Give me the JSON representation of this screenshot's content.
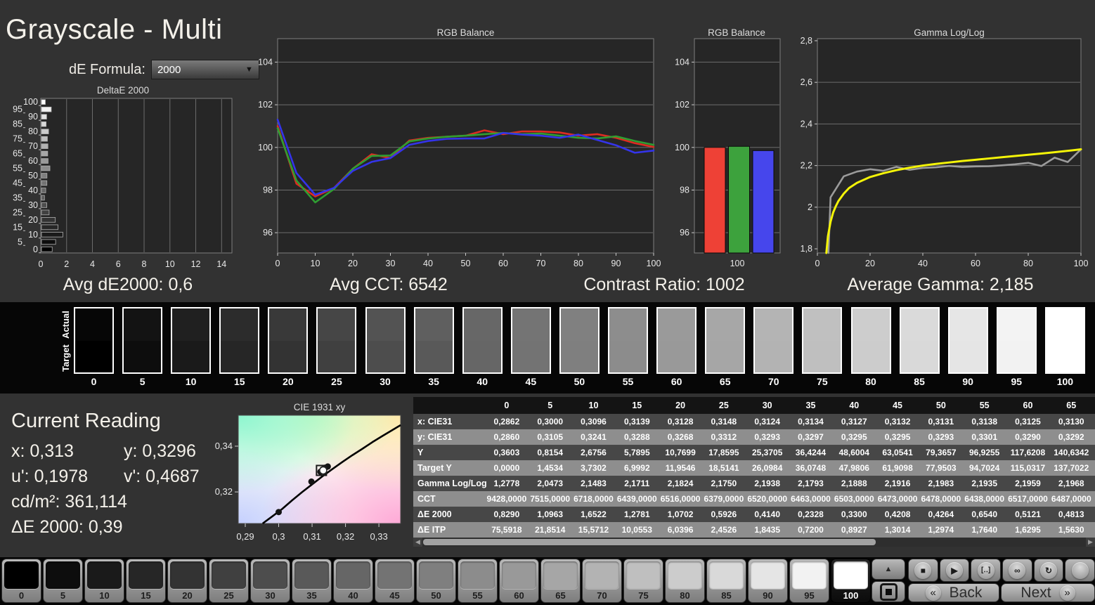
{
  "title": "Grayscale - Multi",
  "de_formula": {
    "label": "dE Formula:",
    "value": "2000"
  },
  "summary": {
    "avg_de": "Avg dE2000: 0,6",
    "avg_cct": "Avg CCT: 6542",
    "contrast": "Contrast Ratio: 1002",
    "avg_gamma": "Average Gamma: 2,185"
  },
  "strip": {
    "actual_label": "Actual",
    "target_label": "Target",
    "levels": [
      0,
      5,
      10,
      15,
      20,
      25,
      30,
      35,
      40,
      45,
      50,
      55,
      60,
      65,
      70,
      75,
      80,
      85,
      90,
      95,
      100
    ]
  },
  "current_reading": {
    "heading": "Current Reading",
    "row1": [
      "x: 0,313",
      "y: 0,3296"
    ],
    "row2": [
      "u': 0,1978",
      "v': 0,4687"
    ],
    "row3": "cd/m²: 361,114",
    "row4": "ΔE 2000: 0,39"
  },
  "table": {
    "col_headers": [
      "0",
      "5",
      "10",
      "15",
      "20",
      "25",
      "30",
      "35",
      "40",
      "45",
      "50",
      "55",
      "60",
      "65"
    ],
    "rows": [
      {
        "label": "x: CIE31",
        "values": [
          "0,2862",
          "0,3000",
          "0,3096",
          "0,3139",
          "0,3128",
          "0,3148",
          "0,3124",
          "0,3134",
          "0,3127",
          "0,3132",
          "0,3131",
          "0,3138",
          "0,3125",
          "0,3130"
        ]
      },
      {
        "label": "y: CIE31",
        "values": [
          "0,2860",
          "0,3105",
          "0,3241",
          "0,3288",
          "0,3268",
          "0,3312",
          "0,3293",
          "0,3297",
          "0,3295",
          "0,3295",
          "0,3293",
          "0,3301",
          "0,3290",
          "0,3292"
        ]
      },
      {
        "label": "Y",
        "values": [
          "0,3603",
          "0,8154",
          "2,6756",
          "5,7895",
          "10,7699",
          "17,8595",
          "25,3705",
          "36,4244",
          "48,6004",
          "63,0541",
          "79,3657",
          "96,9255",
          "117,6208",
          "140,6342"
        ]
      },
      {
        "label": "Target Y",
        "values": [
          "0,0000",
          "1,4534",
          "3,7302",
          "6,9992",
          "11,9546",
          "18,5141",
          "26,0984",
          "36,0748",
          "47,9806",
          "61,9098",
          "77,9503",
          "94,7024",
          "115,0317",
          "137,7022"
        ]
      },
      {
        "label": "Gamma Log/Log",
        "values": [
          "1,2778",
          "2,0473",
          "2,1483",
          "2,1711",
          "2,1824",
          "2,1750",
          "2,1938",
          "2,1793",
          "2,1888",
          "2,1916",
          "2,1983",
          "2,1935",
          "2,1959",
          "2,1968"
        ]
      },
      {
        "label": "CCT",
        "values": [
          "9428,0000",
          "7515,0000",
          "6718,0000",
          "6439,0000",
          "6516,0000",
          "6379,0000",
          "6520,0000",
          "6463,0000",
          "6503,0000",
          "6473,0000",
          "6478,0000",
          "6438,0000",
          "6517,0000",
          "6487,0000"
        ]
      },
      {
        "label": "ΔE 2000",
        "values": [
          "0,8290",
          "1,0963",
          "1,6522",
          "1,2781",
          "1,0702",
          "0,5926",
          "0,4140",
          "0,2328",
          "0,3300",
          "0,4208",
          "0,4264",
          "0,6540",
          "0,5121",
          "0,4813"
        ]
      },
      {
        "label": "ΔE ITP",
        "values": [
          "75,5918",
          "21,8514",
          "15,5712",
          "10,0553",
          "6,0396",
          "2,4526",
          "1,8435",
          "0,7200",
          "0,8927",
          "1,3014",
          "1,2974",
          "1,7640",
          "1,6295",
          "1,5630"
        ]
      }
    ]
  },
  "bottom_bar": {
    "levels": [
      0,
      5,
      10,
      15,
      20,
      25,
      30,
      35,
      40,
      45,
      50,
      55,
      60,
      65,
      70,
      75,
      80,
      85,
      90,
      95,
      100
    ],
    "selected_level": 100,
    "up_icon": "▲",
    "toolbar": [
      {
        "name": "stop-icon",
        "glyph": "■"
      },
      {
        "name": "play-icon",
        "glyph": "▶"
      },
      {
        "name": "single-measure-icon",
        "glyph": "[‥]"
      },
      {
        "name": "continuous-measure-icon",
        "glyph": "∞"
      },
      {
        "name": "refresh-icon",
        "glyph": "↻"
      },
      {
        "name": "blank-icon",
        "glyph": ""
      }
    ],
    "back_icon": "«",
    "back_label": "Back",
    "next_label": "Next",
    "next_icon": "»"
  },
  "chart_data": [
    {
      "id": "deltae",
      "type": "bar",
      "orientation": "horizontal",
      "title": "DeltaE 2000",
      "categories": [
        0,
        5,
        10,
        15,
        20,
        25,
        30,
        35,
        40,
        45,
        50,
        55,
        60,
        65,
        70,
        75,
        80,
        85,
        90,
        95,
        100
      ],
      "values": [
        0.829,
        1.0963,
        1.6522,
        1.2781,
        1.0702,
        0.5926,
        0.414,
        0.2328,
        0.33,
        0.4208,
        0.4264,
        0.654,
        0.5121,
        0.4813,
        0.5,
        0.46,
        0.55,
        0.36,
        0.4,
        0.76,
        0.3
      ],
      "xlim": [
        0,
        14.8
      ],
      "xticks": [
        0,
        2,
        4,
        6,
        8,
        10,
        12,
        14
      ]
    },
    {
      "id": "rgb-line",
      "type": "line",
      "title": "RGB Balance",
      "x": [
        0,
        5,
        10,
        15,
        20,
        25,
        30,
        35,
        40,
        45,
        50,
        55,
        60,
        65,
        70,
        75,
        80,
        85,
        90,
        95,
        100
      ],
      "xlim": [
        0,
        100
      ],
      "ylim": [
        95.05,
        105.1
      ],
      "yticks": [
        {
          "v": 96,
          "l": "96"
        },
        {
          "v": 98,
          "l": "98"
        },
        {
          "v": 100,
          "l": "100"
        },
        {
          "v": 102,
          "l": "102"
        },
        {
          "v": 104,
          "l": "104"
        }
      ],
      "xticks": [
        {
          "v": 0,
          "l": "0"
        },
        {
          "v": 10,
          "l": "10"
        },
        {
          "v": 20,
          "l": "20"
        },
        {
          "v": 30,
          "l": "30"
        },
        {
          "v": 40,
          "l": "40"
        },
        {
          "v": 50,
          "l": "50"
        },
        {
          "v": 60,
          "l": "60"
        },
        {
          "v": 70,
          "l": "70"
        },
        {
          "v": 80,
          "l": "80"
        },
        {
          "v": 90,
          "l": "90"
        },
        {
          "v": 100,
          "l": "100"
        }
      ],
      "series": [
        {
          "name": "red",
          "color": "#dd2c22",
          "values": [
            101.0,
            98.3,
            97.7,
            98.1,
            99.0,
            99.68,
            99.5,
            100.32,
            100.45,
            100.5,
            100.55,
            100.8,
            100.62,
            100.75,
            100.75,
            100.7,
            100.55,
            100.62,
            100.45,
            100.2,
            100.02
          ]
        },
        {
          "name": "green",
          "color": "#2f9e32",
          "values": [
            100.9,
            98.45,
            97.42,
            98.05,
            99.0,
            99.6,
            99.62,
            100.28,
            100.42,
            100.5,
            100.55,
            100.62,
            100.68,
            100.62,
            100.65,
            100.55,
            100.45,
            100.42,
            100.52,
            100.3,
            100.12
          ]
        },
        {
          "name": "blue",
          "color": "#3434ea",
          "values": [
            101.3,
            98.8,
            97.78,
            98.1,
            98.9,
            99.32,
            99.5,
            100.12,
            100.3,
            100.4,
            100.42,
            100.42,
            100.68,
            100.6,
            100.55,
            100.45,
            100.6,
            100.35,
            100.1,
            99.75,
            99.85
          ]
        }
      ]
    },
    {
      "id": "rgb-bars",
      "type": "bar",
      "title": "RGB Balance",
      "category_label": "100",
      "ylim": [
        95.05,
        105.1
      ],
      "yticks": [
        {
          "v": 96,
          "l": "96"
        },
        {
          "v": 98,
          "l": "98"
        },
        {
          "v": 100,
          "l": "100"
        },
        {
          "v": 102,
          "l": "102"
        },
        {
          "v": 104,
          "l": "104"
        }
      ],
      "bars": [
        {
          "name": "red",
          "color": "#ee4136",
          "value": 100.0
        },
        {
          "name": "green",
          "color": "#3da23d",
          "value": 100.05
        },
        {
          "name": "blue",
          "color": "#4646ec",
          "value": 99.85
        }
      ]
    },
    {
      "id": "gamma",
      "type": "line",
      "title": "Gamma Log/Log",
      "xlim": [
        0,
        100
      ],
      "ylim": [
        1.78,
        2.81
      ],
      "yticks": [
        {
          "v": 1.8,
          "l": "1,8"
        },
        {
          "v": 2,
          "l": "2"
        },
        {
          "v": 2.2,
          "l": "2,2"
        },
        {
          "v": 2.4,
          "l": "2,4"
        },
        {
          "v": 2.6,
          "l": "2,6"
        },
        {
          "v": 2.8,
          "l": "2,8"
        }
      ],
      "xticks": [
        {
          "v": 0,
          "l": "0"
        },
        {
          "v": 20,
          "l": "20"
        },
        {
          "v": 40,
          "l": "40"
        },
        {
          "v": 60,
          "l": "60"
        },
        {
          "v": 80,
          "l": "80"
        },
        {
          "v": 100,
          "l": "100"
        }
      ],
      "series": [
        {
          "name": "measured",
          "color": "#9b9b9b",
          "points": [
            [
              4.2,
              1.78
            ],
            [
              5,
              2.0473
            ],
            [
              10,
              2.1483
            ],
            [
              15,
              2.1711
            ],
            [
              20,
              2.1824
            ],
            [
              25,
              2.175
            ],
            [
              30,
              2.1938
            ],
            [
              35,
              2.1793
            ],
            [
              40,
              2.1888
            ],
            [
              45,
              2.1916
            ],
            [
              50,
              2.1983
            ],
            [
              55,
              2.1935
            ],
            [
              60,
              2.1959
            ],
            [
              65,
              2.1968
            ],
            [
              70,
              2.201
            ],
            [
              75,
              2.206
            ],
            [
              80,
              2.213
            ],
            [
              85,
              2.198
            ],
            [
              90,
              2.238
            ],
            [
              95,
              2.217
            ],
            [
              100,
              2.278
            ]
          ]
        },
        {
          "name": "reference",
          "color": "#f4f408",
          "points": [
            [
              3.4,
              1.78
            ],
            [
              4,
              1.86
            ],
            [
              5,
              1.93
            ],
            [
              6,
              1.975
            ],
            [
              7,
              2.005
            ],
            [
              8,
              2.03
            ],
            [
              10,
              2.065
            ],
            [
              12,
              2.092
            ],
            [
              15,
              2.117
            ],
            [
              20,
              2.145
            ],
            [
              25,
              2.163
            ],
            [
              30,
              2.178
            ],
            [
              35,
              2.19
            ],
            [
              40,
              2.2
            ],
            [
              45,
              2.208
            ],
            [
              50,
              2.215
            ],
            [
              55,
              2.222
            ],
            [
              60,
              2.228
            ],
            [
              65,
              2.234
            ],
            [
              70,
              2.24
            ],
            [
              75,
              2.246
            ],
            [
              80,
              2.252
            ],
            [
              85,
              2.258
            ],
            [
              90,
              2.264
            ],
            [
              95,
              2.271
            ],
            [
              100,
              2.278
            ]
          ]
        }
      ]
    },
    {
      "id": "cie",
      "type": "scatter",
      "title": "CIE 1931 xy",
      "xlim": [
        0.2879,
        0.3365
      ],
      "ylim": [
        0.3062,
        0.3535
      ],
      "xticks": [
        {
          "v": 0.29,
          "l": "0,29"
        },
        {
          "v": 0.3,
          "l": "0,3"
        },
        {
          "v": 0.31,
          "l": "0,31"
        },
        {
          "v": 0.32,
          "l": "0,32"
        },
        {
          "v": 0.33,
          "l": "0,33"
        }
      ],
      "yticks": [
        {
          "v": 0.32,
          "l": "0,32"
        },
        {
          "v": 0.34,
          "l": "0,34"
        }
      ],
      "locus": [
        [
          0.2952,
          0.3062
        ],
        [
          0.298,
          0.3092
        ],
        [
          0.301,
          0.3125
        ],
        [
          0.304,
          0.3163
        ],
        [
          0.307,
          0.3199
        ],
        [
          0.31,
          0.3233
        ],
        [
          0.313,
          0.3267
        ],
        [
          0.316,
          0.3299
        ],
        [
          0.319,
          0.333
        ],
        [
          0.322,
          0.336
        ],
        [
          0.325,
          0.3388
        ],
        [
          0.328,
          0.3417
        ],
        [
          0.331,
          0.3444
        ],
        [
          0.334,
          0.347
        ],
        [
          0.3365,
          0.3492
        ]
      ],
      "points": [
        [
          0.3,
          0.3112
        ],
        [
          0.3098,
          0.3245
        ],
        [
          0.3125,
          0.3288
        ],
        [
          0.3132,
          0.3299
        ],
        [
          0.314,
          0.3306
        ],
        [
          0.3147,
          0.3311
        ],
        [
          0.3136,
          0.3287
        ]
      ],
      "marker": {
        "x": 0.3128,
        "y": 0.3294
      }
    }
  ]
}
